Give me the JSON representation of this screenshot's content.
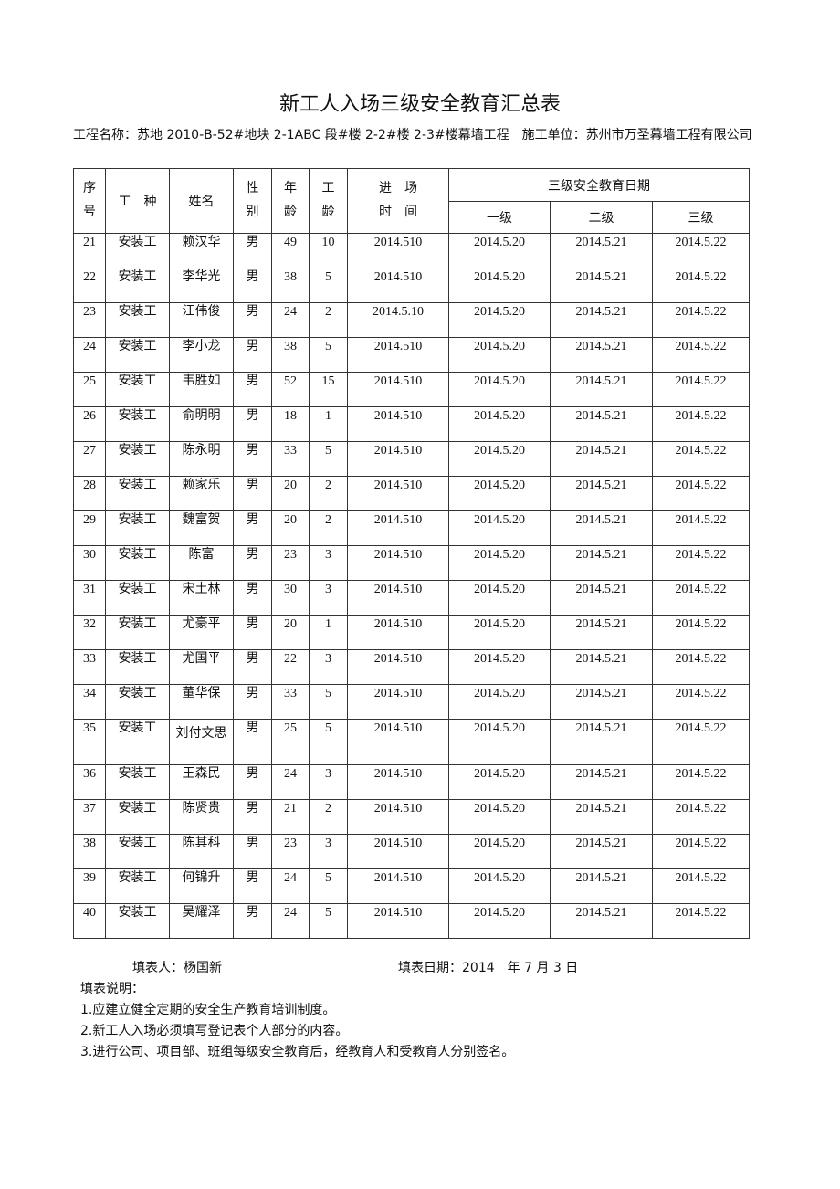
{
  "document": {
    "title": "新工人入场三级安全教育汇总表",
    "project_line": "工程名称：苏地 2010-B-52#地块 2-1ABC 段#楼 2-2#楼 2-3#楼幕墙工程　施工单位：苏州市万圣幕墙工程有限公司"
  },
  "table": {
    "headers": {
      "seq_line1": "序",
      "seq_line2": "号",
      "trade": "工　种",
      "name": "姓名",
      "gender_line1": "性",
      "gender_line2": "别",
      "age_line1": "年",
      "age_line2": "龄",
      "seniority_line1": "工",
      "seniority_line2": "龄",
      "entry_line1": "进　场",
      "entry_line2": "时　间",
      "education_group": "三级安全教育日期",
      "level1": "一级",
      "level2": "二级",
      "level3": "三级"
    },
    "rows": [
      {
        "seq": "21",
        "trade": "安装工",
        "name": "赖汉华",
        "gender": "男",
        "age": "49",
        "seniority": "10",
        "entry": "2014.510",
        "l1": "2014.5.20",
        "l2": "2014.5.21",
        "l3": "2014.5.22"
      },
      {
        "seq": "22",
        "trade": "安装工",
        "name": "李华光",
        "gender": "男",
        "age": "38",
        "seniority": "5",
        "entry": "2014.510",
        "l1": "2014.5.20",
        "l2": "2014.5.21",
        "l3": "2014.5.22"
      },
      {
        "seq": "23",
        "trade": "安装工",
        "name": "江伟俊",
        "gender": "男",
        "age": "24",
        "seniority": "2",
        "entry": "2014.5.10",
        "l1": "2014.5.20",
        "l2": "2014.5.21",
        "l3": "2014.5.22"
      },
      {
        "seq": "24",
        "trade": "安装工",
        "name": "李小龙",
        "gender": "男",
        "age": "38",
        "seniority": "5",
        "entry": "2014.510",
        "l1": "2014.5.20",
        "l2": "2014.5.21",
        "l3": "2014.5.22"
      },
      {
        "seq": "25",
        "trade": "安装工",
        "name": "韦胜如",
        "gender": "男",
        "age": "52",
        "seniority": "15",
        "entry": "2014.510",
        "l1": "2014.5.20",
        "l2": "2014.5.21",
        "l3": "2014.5.22"
      },
      {
        "seq": "26",
        "trade": "安装工",
        "name": "俞明明",
        "gender": "男",
        "age": "18",
        "seniority": "1",
        "entry": "2014.510",
        "l1": "2014.5.20",
        "l2": "2014.5.21",
        "l3": "2014.5.22"
      },
      {
        "seq": "27",
        "trade": "安装工",
        "name": "陈永明",
        "gender": "男",
        "age": "33",
        "seniority": "5",
        "entry": "2014.510",
        "l1": "2014.5.20",
        "l2": "2014.5.21",
        "l3": "2014.5.22"
      },
      {
        "seq": "28",
        "trade": "安装工",
        "name": "赖家乐",
        "gender": "男",
        "age": "20",
        "seniority": "2",
        "entry": "2014.510",
        "l1": "2014.5.20",
        "l2": "2014.5.21",
        "l3": "2014.5.22"
      },
      {
        "seq": "29",
        "trade": "安装工",
        "name": "魏富贺",
        "gender": "男",
        "age": "20",
        "seniority": "2",
        "entry": "2014.510",
        "l1": "2014.5.20",
        "l2": "2014.5.21",
        "l3": "2014.5.22"
      },
      {
        "seq": "30",
        "trade": "安装工",
        "name": "陈富",
        "gender": "男",
        "age": "23",
        "seniority": "3",
        "entry": "2014.510",
        "l1": "2014.5.20",
        "l2": "2014.5.21",
        "l3": "2014.5.22"
      },
      {
        "seq": "31",
        "trade": "安装工",
        "name": "宋土林",
        "gender": "男",
        "age": "30",
        "seniority": "3",
        "entry": "2014.510",
        "l1": "2014.5.20",
        "l2": "2014.5.21",
        "l3": "2014.5.22"
      },
      {
        "seq": "32",
        "trade": "安装工",
        "name": "尤豪平",
        "gender": "男",
        "age": "20",
        "seniority": "1",
        "entry": "2014.510",
        "l1": "2014.5.20",
        "l2": "2014.5.21",
        "l3": "2014.5.22"
      },
      {
        "seq": "33",
        "trade": "安装工",
        "name": "尤国平",
        "gender": "男",
        "age": "22",
        "seniority": "3",
        "entry": "2014.510",
        "l1": "2014.5.20",
        "l2": "2014.5.21",
        "l3": "2014.5.22"
      },
      {
        "seq": "34",
        "trade": "安装工",
        "name": "董华保",
        "gender": "男",
        "age": "33",
        "seniority": "5",
        "entry": "2014.510",
        "l1": "2014.5.20",
        "l2": "2014.5.21",
        "l3": "2014.5.22"
      },
      {
        "seq": "35",
        "trade": "安装工",
        "name": "刘付文思",
        "gender": "男",
        "age": "25",
        "seniority": "5",
        "entry": "2014.510",
        "l1": "2014.5.20",
        "l2": "2014.5.21",
        "l3": "2014.5.22"
      },
      {
        "seq": "36",
        "trade": "安装工",
        "name": "王森民",
        "gender": "男",
        "age": "24",
        "seniority": "3",
        "entry": "2014.510",
        "l1": "2014.5.20",
        "l2": "2014.5.21",
        "l3": "2014.5.22"
      },
      {
        "seq": "37",
        "trade": "安装工",
        "name": "陈贤贵",
        "gender": "男",
        "age": "21",
        "seniority": "2",
        "entry": "2014.510",
        "l1": "2014.5.20",
        "l2": "2014.5.21",
        "l3": "2014.5.22"
      },
      {
        "seq": "38",
        "trade": "安装工",
        "name": "陈其科",
        "gender": "男",
        "age": "23",
        "seniority": "3",
        "entry": "2014.510",
        "l1": "2014.5.20",
        "l2": "2014.5.21",
        "l3": "2014.5.22"
      },
      {
        "seq": "39",
        "trade": "安装工",
        "name": "何锦升",
        "gender": "男",
        "age": "24",
        "seniority": "5",
        "entry": "2014.510",
        "l1": "2014.5.20",
        "l2": "2014.5.21",
        "l3": "2014.5.22"
      },
      {
        "seq": "40",
        "trade": "安装工",
        "name": "吴耀泽",
        "gender": "男",
        "age": "24",
        "seniority": "5",
        "entry": "2014.510",
        "l1": "2014.5.20",
        "l2": "2014.5.21",
        "l3": "2014.5.22"
      }
    ]
  },
  "footer": {
    "filled_by": "填表人：杨国新",
    "fill_date": "填表日期：2014　年 7 月 3 日"
  },
  "notes": {
    "heading": "填表说明：",
    "items": [
      "1.应建立健全定期的安全生产教育培训制度。",
      "2.新工人入场必须填写登记表个人部分的内容。",
      "3.进行公司、项目部、班组每级安全教育后，经教育人和受教育人分别签名。"
    ]
  }
}
